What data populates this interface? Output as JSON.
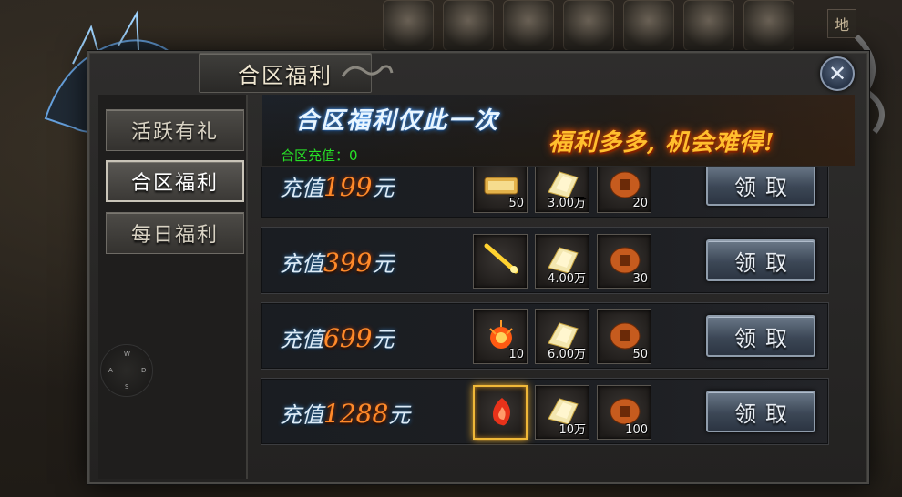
{
  "panel": {
    "title": "合区福利",
    "close_label": "✕"
  },
  "tabs": [
    {
      "label": "活跃有礼"
    },
    {
      "label": "合区福利"
    },
    {
      "label": "每日福利"
    }
  ],
  "banner": {
    "title": "合区福利仅此一次",
    "slogan": "福利多多, 机会难得!",
    "recharge_label": "合区充值：0"
  },
  "rows": [
    {
      "prefix": "充值",
      "amount": "199",
      "suffix": "元",
      "items": [
        {
          "icon": "scroll-icon",
          "count": "50"
        },
        {
          "icon": "gold-ingot-icon",
          "count": "3.00万"
        },
        {
          "icon": "bronze-coin-icon",
          "count": "20"
        }
      ],
      "button": "领取"
    },
    {
      "prefix": "充值",
      "amount": "399",
      "suffix": "元",
      "items": [
        {
          "icon": "golden-sword-icon",
          "count": ""
        },
        {
          "icon": "gold-ingot-icon",
          "count": "4.00万"
        },
        {
          "icon": "bronze-coin-icon",
          "count": "30"
        }
      ],
      "button": "领取"
    },
    {
      "prefix": "充值",
      "amount": "699",
      "suffix": "元",
      "items": [
        {
          "icon": "fire-orb-icon",
          "count": "10"
        },
        {
          "icon": "gold-ingot-icon",
          "count": "6.00万"
        },
        {
          "icon": "bronze-coin-icon",
          "count": "50"
        }
      ],
      "button": "领取"
    },
    {
      "prefix": "充值",
      "amount": "1288",
      "suffix": "元",
      "items": [
        {
          "icon": "fire-spirit-icon",
          "count": ""
        },
        {
          "icon": "gold-ingot-icon",
          "count": "10万"
        },
        {
          "icon": "bronze-coin-icon",
          "count": "100"
        }
      ],
      "button": "领取"
    }
  ],
  "hud": {
    "corner_char": "地",
    "dpad": {
      "up": "W",
      "left": "A",
      "right": "D",
      "down": "S"
    }
  },
  "colors": {
    "accent_orange": "#ff8a2a",
    "slogan_gold": "#ffbf2e",
    "recharge_green": "#27e027"
  }
}
